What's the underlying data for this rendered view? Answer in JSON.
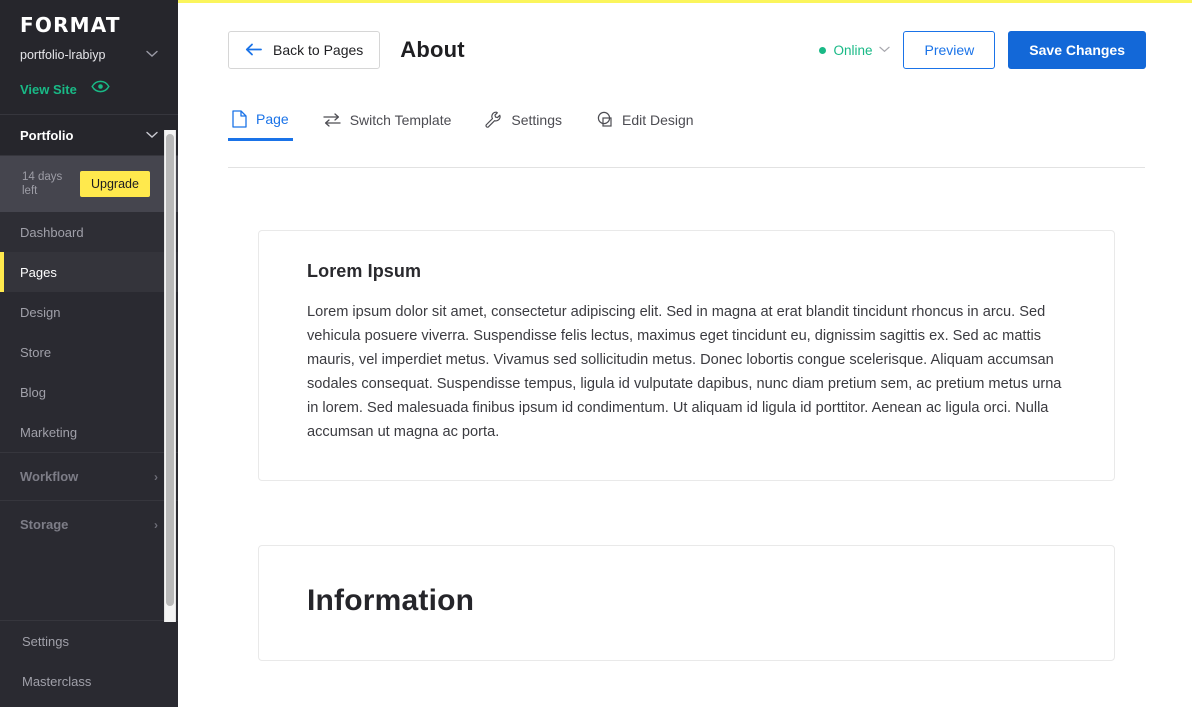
{
  "sidebar": {
    "brand": "FORMAT",
    "site_name": "portfolio-lrabiyp",
    "site_chevron": "chevron-down",
    "view_site_label": "View Site",
    "section_header": "Portfolio",
    "trial": {
      "days_left": "14 days left",
      "upgrade_label": "Upgrade"
    },
    "nav_items": [
      {
        "label": "Dashboard",
        "active": false
      },
      {
        "label": "Pages",
        "active": true
      },
      {
        "label": "Design",
        "active": false
      },
      {
        "label": "Store",
        "active": false
      },
      {
        "label": "Blog",
        "active": false
      },
      {
        "label": "Marketing",
        "active": false
      }
    ],
    "groups": [
      {
        "label": "Workflow",
        "arrow": "›"
      },
      {
        "label": "Storage",
        "arrow": "›"
      }
    ],
    "bottom_items": [
      {
        "label": "Settings"
      },
      {
        "label": "Masterclass"
      }
    ]
  },
  "header": {
    "back_label": "Back to Pages",
    "page_title": "About",
    "status_label": "Online",
    "status_color": "#19b986",
    "preview_label": "Preview",
    "save_label": "Save Changes",
    "accent_color": "#fbf55c",
    "primary_color": "#1368d8"
  },
  "tabs": [
    {
      "label": "Page",
      "icon": "page-icon",
      "active": true
    },
    {
      "label": "Switch Template",
      "icon": "swap-icon",
      "active": false
    },
    {
      "label": "Settings",
      "icon": "wrench-icon",
      "active": false
    },
    {
      "label": "Edit Design",
      "icon": "design-icon",
      "active": false
    }
  ],
  "content": {
    "blocks": [
      {
        "heading": "Lorem Ipsum",
        "body": "Lorem ipsum dolor sit amet, consectetur adipiscing elit. Sed in magna at erat blandit tincidunt rhoncus in arcu. Sed vehicula posuere viverra. Suspendisse felis lectus, maximus eget tincidunt eu, dignissim sagittis ex. Sed ac mattis mauris, vel imperdiet metus. Vivamus sed sollicitudin metus. Donec lobortis congue scelerisque. Aliquam accumsan sodales consequat. Suspendisse tempus, ligula id vulputate dapibus, nunc diam pretium sem, ac pretium metus urna in lorem. Sed malesuada finibus ipsum id condimentum. Ut aliquam id ligula id porttitor. Aenean ac ligula orci. Nulla accumsan ut magna ac porta."
      },
      {
        "heading": "Information"
      }
    ]
  }
}
